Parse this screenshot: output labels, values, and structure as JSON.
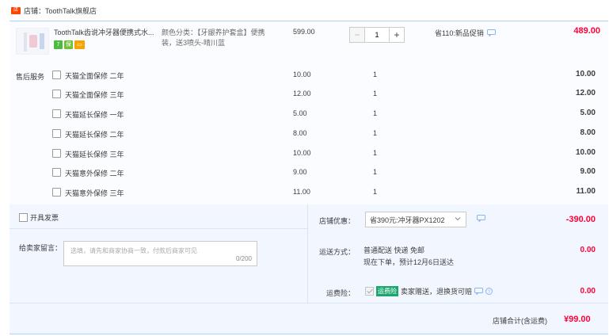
{
  "store": {
    "icon": "store-icon",
    "name": "店铺：ToothTalk旗舰店"
  },
  "product": {
    "title": "ToothTalk齿说冲牙器便携式水...",
    "badges": [
      "7",
      "保"
    ],
    "sku": "颜色分类：【牙龈养护套盒】便携装，送3喷头-晴川蓝",
    "price": "599.00",
    "quantity": "1",
    "promo": "省110:新品促销",
    "total": "489.00"
  },
  "services": {
    "label": "售后服务",
    "items": [
      {
        "name": "天猫全面保修 二年",
        "price": "10.00",
        "qty": "1",
        "total": "10.00"
      },
      {
        "name": "天猫全面保修 三年",
        "price": "12.00",
        "qty": "1",
        "total": "12.00"
      },
      {
        "name": "天猫延长保修 一年",
        "price": "5.00",
        "qty": "1",
        "total": "5.00"
      },
      {
        "name": "天猫延长保修 二年",
        "price": "8.00",
        "qty": "1",
        "total": "8.00"
      },
      {
        "name": "天猫延长保修 三年",
        "price": "10.00",
        "qty": "1",
        "total": "10.00"
      },
      {
        "name": "天猫意外保修 二年",
        "price": "9.00",
        "qty": "1",
        "total": "9.00"
      },
      {
        "name": "天猫意外保修 三年",
        "price": "11.00",
        "qty": "1",
        "total": "11.00"
      }
    ]
  },
  "invoice": {
    "label": "开具发票"
  },
  "message": {
    "label": "给卖家留言：",
    "placeholder": "选填，请先和商家协商一致，付款后商家可见",
    "counter": "0/200"
  },
  "coupon": {
    "label": "店铺优惠：",
    "selected": "省390元:冲牙器PX1202",
    "amount": "-390.00"
  },
  "shipping": {
    "label": "运送方式：",
    "line1": "普通配送 快递 免邮",
    "line2": "现在下单，预计12月6日送达",
    "amount": "0.00"
  },
  "insurance": {
    "label": "运费险：",
    "badge": "运费险",
    "text": "卖家赠送，退换货可赔",
    "amount": "0.00"
  },
  "summary": {
    "label": "店铺合计(含运费)",
    "amount": "¥99.00"
  },
  "colors": {
    "accent": "#ff0036",
    "border_blue": "#b2d1ff",
    "panel_blue": "#f2f7ff",
    "store_icon": "#ff4400"
  }
}
